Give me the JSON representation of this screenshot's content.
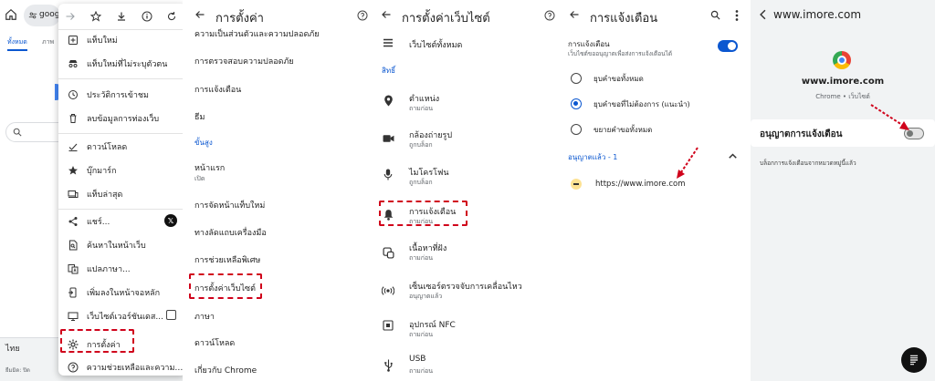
{
  "panel1": {
    "address_text": "goog",
    "tabs": [
      "ทั้งหมด",
      "ภาพ"
    ],
    "footer_language": "ไทย",
    "footer_small": "ยืมมิด: ปิด",
    "menu": {
      "toolbar_icons": [
        "forward-icon",
        "star-icon",
        "download-icon",
        "info-icon",
        "reload-icon"
      ],
      "items": [
        {
          "icon": "new-tab-icon",
          "label": "แท็บใหม่"
        },
        {
          "icon": "incognito-icon",
          "label": "แท็บใหม่ที่ไม่ระบุตัวตน"
        },
        {
          "icon": "history-icon",
          "label": "ประวัติการเข้าชม"
        },
        {
          "icon": "trash-icon",
          "label": "ลบข้อมูลการท่องเว็บ"
        },
        {
          "icon": "downloads-icon",
          "label": "ดาวน์โหลด"
        },
        {
          "icon": "bookmark-star-icon",
          "label": "บุ๊กมาร์ก"
        },
        {
          "icon": "recent-tabs-icon",
          "label": "แท็บล่าสุด"
        },
        {
          "icon": "share-icon",
          "label": "แชร์..."
        },
        {
          "icon": "find-in-page-icon",
          "label": "ค้นหาในหน้าเว็บ"
        },
        {
          "icon": "translate-icon",
          "label": "แปลภาษา..."
        },
        {
          "icon": "add-to-home-icon",
          "label": "เพิ่มลงในหน้าจอหลัก"
        },
        {
          "icon": "desktop-site-icon",
          "label": "เว็บไซต์เวอร์ชันเดส..."
        },
        {
          "icon": "settings-gear-icon",
          "label": "การตั้งค่า"
        },
        {
          "icon": "help-icon",
          "label": "ความช่วยเหลือและความคิ..."
        }
      ]
    }
  },
  "panel2": {
    "title": "การตั้งค่า",
    "items": [
      {
        "label": "ความเป็นส่วนตัวและความปลอดภัย"
      },
      {
        "label": "การตรวจสอบความปลอดภัย"
      },
      {
        "label": "การแจ้งเตือน"
      },
      {
        "label": "ธีม"
      }
    ],
    "section_advanced": "ขั้นสูง",
    "homepage": {
      "label": "หน้าแรก",
      "sub": "เปิด"
    },
    "items2": [
      {
        "label": "การจัดหน้าแท็บใหม่"
      },
      {
        "label": "ทางลัดแถบเครื่องมือ"
      },
      {
        "label": "การช่วยเหลือพิเศษ"
      },
      {
        "label": "การตั้งค่าเว็บไซต์"
      },
      {
        "label": "ภาษา"
      },
      {
        "label": "ดาวน์โหลด"
      },
      {
        "label": "เกี่ยวกับ Chrome"
      }
    ]
  },
  "panel3": {
    "title": "การตั้งค่าเว็บไซต์",
    "all_sites": "เว็บไซต์ทั้งหมด",
    "section_permissions": "สิทธิ์",
    "items": [
      {
        "icon": "location-icon",
        "label": "ตำแหน่ง",
        "sub": "ถามก่อน"
      },
      {
        "icon": "camera-icon",
        "label": "กล้องถ่ายรูป",
        "sub": "ถูกบล็อก"
      },
      {
        "icon": "microphone-icon",
        "label": "ไมโครโฟน",
        "sub": "ถูกบล็อก"
      },
      {
        "icon": "bell-icon",
        "label": "การแจ้งเตือน",
        "sub": "ถามก่อน"
      },
      {
        "icon": "embedded-content-icon",
        "label": "เนื้อหาที่ฝัง",
        "sub": "ถามก่อน"
      },
      {
        "icon": "motion-sensor-icon",
        "label": "เซ็นเซอร์ตรวจจับการเคลื่อนไหว",
        "sub": "อนุญาตแล้ว"
      },
      {
        "icon": "nfc-icon",
        "label": "อุปกรณ์ NFC",
        "sub": "ถามก่อน"
      },
      {
        "icon": "usb-icon",
        "label": "USB",
        "sub": "ถามก่อน"
      }
    ]
  },
  "panel4": {
    "title": "การแจ้งเตือน",
    "toggle_title": "การแจ้งเตือน",
    "toggle_sub": "เว็บไซต์ขออนุญาตเพื่อส่งการแจ้งเตือนได้",
    "toggle_on": true,
    "radios": [
      {
        "label": "ยุบคำขอทั้งหมด",
        "selected": false
      },
      {
        "label": "ยุบคำขอที่ไม่ต้องการ (แนะนำ)",
        "selected": true
      },
      {
        "label": "ขยายคำขอทั้งหมด",
        "selected": false
      }
    ],
    "allowed_label": "อนุญาตแล้ว - 1",
    "site_url": "https://www.imore.com"
  },
  "panel5": {
    "header_title": "www.imore.com",
    "site_name": "www.imore.com",
    "site_sub": "Chrome • เว็บไซต์",
    "permission_label": "อนุญาตการแจ้งเตือน",
    "permission_on": false,
    "footer_text": "บล็อกการแจ้งเตือนจากหมวดหมู่นี้แล้ว"
  }
}
